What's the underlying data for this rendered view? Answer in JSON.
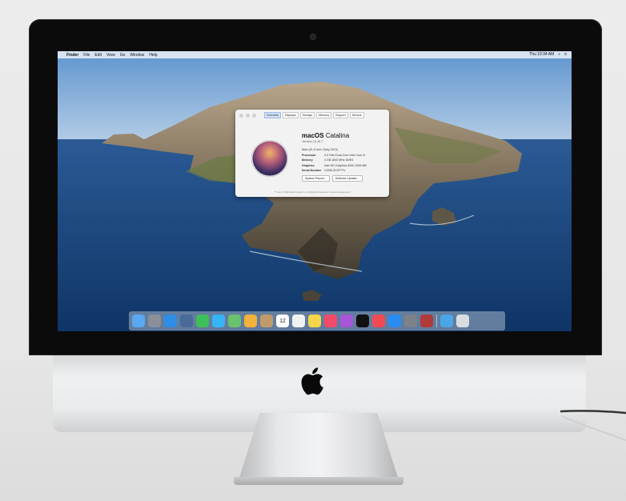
{
  "menubar": {
    "apple_glyph": "",
    "items": [
      "Finder",
      "File",
      "Edit",
      "View",
      "Go",
      "Window",
      "Help"
    ],
    "clock": "Thu 10:34 AM"
  },
  "about": {
    "tabs": [
      "Overview",
      "Displays",
      "Storage",
      "Memory",
      "Support",
      "Service"
    ],
    "title_bold": "macOS",
    "title_name": "Catalina",
    "version": "Version 10.15.7",
    "specs": [
      {
        "key": "",
        "value": "iMac (21.5-inch, Early 2013)"
      },
      {
        "key": "Processor",
        "value": "3.3 GHz Dual-Core Intel Core i3"
      },
      {
        "key": "Memory",
        "value": "4 GB 1600 MHz DDR3"
      },
      {
        "key": "Graphics",
        "value": "Intel HD Graphics 4000 1536 MB"
      },
      {
        "key": "Serial Number",
        "value": "C02KL3C2F7YV"
      }
    ],
    "buttons": [
      "System Report...",
      "Software Update..."
    ],
    "copyright": "™ and © 1983-2020 Apple Inc. All Rights Reserved. License Agreement"
  },
  "dock": {
    "apps": [
      {
        "icon": "finder-icon",
        "color": "#5aa8f0"
      },
      {
        "icon": "launchpad-icon",
        "color": "#8a8f99"
      },
      {
        "icon": "safari-icon",
        "color": "#2e8fe8"
      },
      {
        "icon": "photo-booth-icon",
        "color": "#4a6a9a"
      },
      {
        "icon": "facetime-icon",
        "color": "#3fbf5a"
      },
      {
        "icon": "messages-icon",
        "color": "#37b4f5"
      },
      {
        "icon": "maps-icon",
        "color": "#6ac26c"
      },
      {
        "icon": "photos-icon",
        "color": "#f3b23a"
      },
      {
        "icon": "contacts-icon",
        "color": "#c19a6b"
      },
      {
        "icon": "calendar-icon",
        "color": "#ffffff"
      },
      {
        "icon": "reminders-icon",
        "color": "#f2f2f2"
      },
      {
        "icon": "notes-icon",
        "color": "#f5d64a"
      },
      {
        "icon": "music-icon",
        "color": "#f44a6a"
      },
      {
        "icon": "podcasts-icon",
        "color": "#a855d8"
      },
      {
        "icon": "tv-icon",
        "color": "#111111"
      },
      {
        "icon": "news-icon",
        "color": "#f04a55"
      },
      {
        "icon": "app-store-icon",
        "color": "#2a8cf2"
      },
      {
        "icon": "system-preferences-icon",
        "color": "#7d8188"
      },
      {
        "icon": "photo-app-icon",
        "color": "#b03a3a"
      }
    ],
    "trailing": [
      {
        "icon": "downloads-folder-icon",
        "color": "#4aa6e8"
      },
      {
        "icon": "trash-icon",
        "color": "#d9dde2"
      }
    ],
    "calendar_day": "12"
  }
}
